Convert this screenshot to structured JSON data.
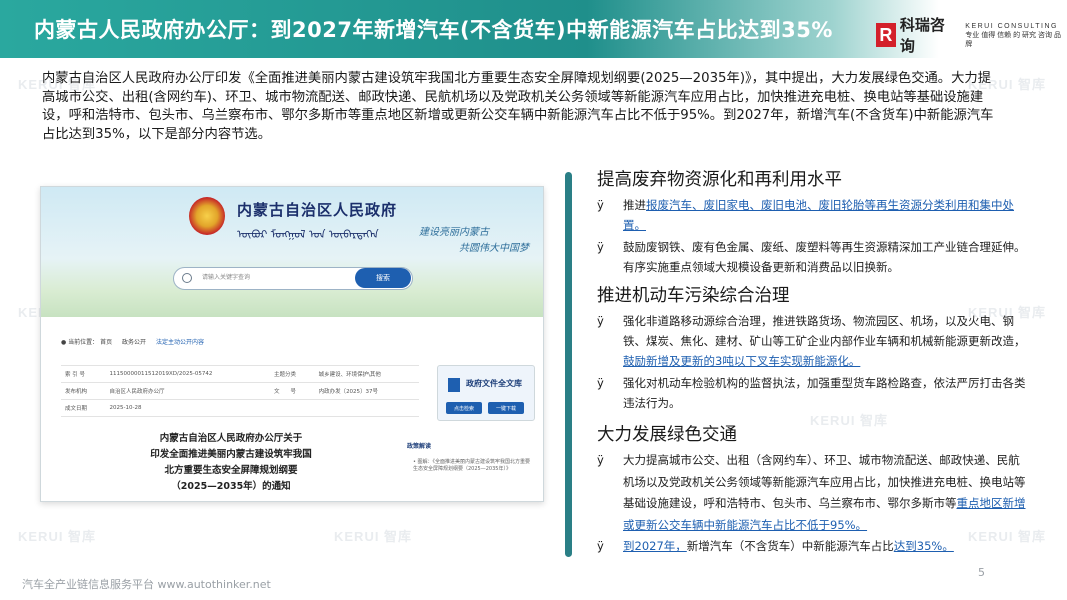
{
  "header": {
    "title": "内蒙古人民政府办公厅：到2027年新增汽车(不含货车)中新能源汽车占比达到35%",
    "logo_mark": "R",
    "logo_name": "科瑞咨询",
    "logo_en_line1": "KERUI CONSULTING",
    "logo_en_line2": "专业 值得 信赖 的 研究 咨询 品牌"
  },
  "intro": "内蒙古自治区人民政府办公厅印发《全面推进美丽内蒙古建设筑牢我国北方重要生态安全屏障规划纲要(2025—2035年)》，其中提出，大力发展绿色交通。大力提高城市公交、出租(含网约车)、环卫、城市物流配送、邮政快递、民航机场以及党政机关公务领域等新能源汽车应用占比，加快推进充电桩、换电站等基础设施建设，呼和浩特市、包头市、乌兰察布市、鄂尔多斯市等重点地区新增或更新公交车辆中新能源汽车占比不低于95%。到2027年，新增汽车(不含货车)中新能源汽车占比达到35%，以下是部分内容节选。",
  "screenshot": {
    "gov_title": "内蒙古自治区人民政府",
    "mongol_text": "ᠥᠪᠦᠷ ᠮᠣᠩᠭᠣᠯ ᠤᠨ ᠥᠪᠡᠷᠲᠡᠭᠡᠨ",
    "slogan_line1": "建设亮丽内蒙古",
    "slogan_line2": "共圆伟大中国梦",
    "search_placeholder": "请输入关键字查询",
    "search_button": "搜索",
    "crumb_label": "当前位置：",
    "crumb_home": "首页",
    "crumb_section": "政务公开",
    "crumb_current": "法定主动公开内容",
    "table_rows": [
      [
        "索 引 号",
        "11150000011512019XD/2025-05742",
        "主题分类",
        "城乡建设、环境保护\\其他"
      ],
      [
        "发布机构",
        "自治区人民政府办公厅",
        "文　　号",
        "内政办发〔2025〕37号"
      ],
      [
        "成文日期",
        "2025-10-28",
        "",
        ""
      ]
    ],
    "card_title": "政府文件全文库",
    "card_btn1": "点击检索",
    "card_btn2": "一键下载",
    "policy_head": "政策解读",
    "policy_item": "• 图解：《全面推进美丽内蒙古建设筑牢我国北方重要生态安全屏障规划纲要（2025—2035年）》",
    "doc_heading_lines": [
      "内蒙古自治区人民政府办公厅关于",
      "印发全面推进美丽内蒙古建设筑牢我国",
      "北方重要生态安全屏障规划纲要",
      "（2025—2035年）的通知"
    ]
  },
  "sections": [
    {
      "title": "提高废弃物资源化和再利用水平",
      "bullets": [
        {
          "mark": "ÿ",
          "prefix": "推进",
          "highlight": "报废汽车、废旧家电、废旧电池、废旧轮胎等再生资源分类利用和集中处置。",
          "suffix": ""
        },
        {
          "mark": "ÿ",
          "prefix": "鼓励废钢铁、废有色金属、废纸、废塑料等再生资源精深加工产业链合理延伸。有序实施重点领域大规模设备更新和消费品以旧换新。",
          "highlight": "",
          "suffix": ""
        }
      ]
    },
    {
      "title": "推进机动车污染综合治理",
      "bullets": [
        {
          "mark": "ÿ",
          "prefix": "强化非道路移动源综合治理，推进铁路货场、物流园区、机场，以及火电、钢铁、煤炭、焦化、建材、矿山等工矿企业内部作业车辆和机械新能源更新改造，",
          "highlight": "鼓励新增及更新的3吨以下叉车实现新能源化。",
          "suffix": ""
        },
        {
          "mark": "ÿ",
          "prefix": "强化对机动车检验机构的监督执法，加强重型货车路检路查，依法严厉打击各类违法行为。",
          "highlight": "",
          "suffix": ""
        }
      ]
    },
    {
      "title": "大力发展绿色交通",
      "bullets": [
        {
          "mark": "ÿ",
          "prefix": "大力提高城市公交、出租（含网约车）、环卫、城市物流配送、邮政快递、民航机场以及党政机关公务领域等新能源汽车应用占比，加快推进充电桩、换电站等基础设施建设，呼和浩特市、包头市、乌兰察布市、鄂尔多斯市等",
          "highlight": "重点地区新增或更新公交车辆中新能源汽车占比不低于95%。",
          "suffix": ""
        },
        {
          "mark": "ÿ",
          "prefix": "",
          "highlight": "到2027年，",
          "mid": "新增汽车（不含货车）中新能源汽车占比",
          "highlight2": "达到35%。"
        }
      ]
    }
  ],
  "footer": "汽车全产业链信息服务平台 www.autothinker.net",
  "page_number": "5",
  "watermark_text": "KERUI 智库",
  "colors": {
    "teal": "#2a7f86",
    "link": "#1e5fb0",
    "logo_red": "#d3202a"
  }
}
